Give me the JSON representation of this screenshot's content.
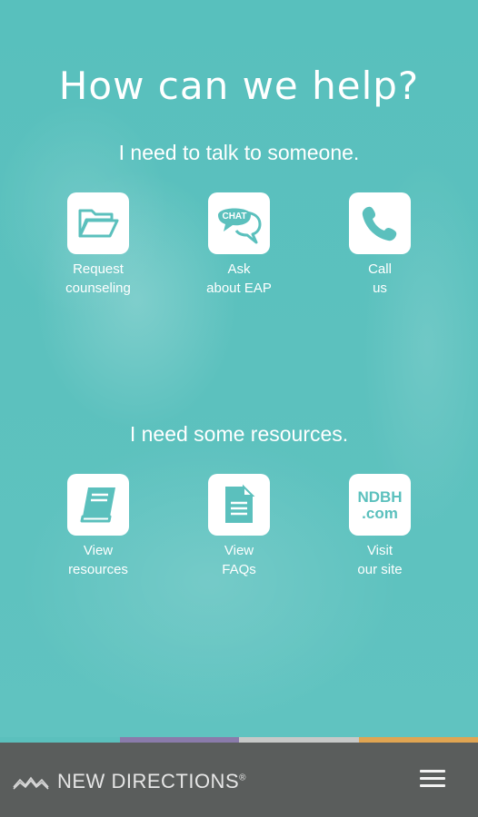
{
  "title": "How can we help?",
  "sections": [
    {
      "heading": "I need to talk to someone.",
      "tiles": [
        {
          "icon": "folder-icon",
          "label_line1": "Request",
          "label_line2": "counseling"
        },
        {
          "icon": "chat-icon",
          "icon_text": "CHAT",
          "label_line1": "Ask",
          "label_line2": "about EAP"
        },
        {
          "icon": "phone-icon",
          "label_line1": "Call",
          "label_line2": "us"
        }
      ]
    },
    {
      "heading": "I need some resources.",
      "tiles": [
        {
          "icon": "book-icon",
          "label_line1": "View",
          "label_line2": "resources"
        },
        {
          "icon": "document-icon",
          "label_line1": "View",
          "label_line2": "FAQs"
        },
        {
          "icon": "website-icon",
          "icon_text_line1": "NDBH",
          "icon_text_line2": ".com",
          "label_line1": "Visit",
          "label_line2": "our site"
        }
      ]
    }
  ],
  "color_bar": [
    "#5bc0bd",
    "#8a7bab",
    "#c7c9c8",
    "#e0a552"
  ],
  "footer": {
    "brand": "NEW DIRECTIONS",
    "brand_mark": "®",
    "menu_icon": "hamburger-menu-icon"
  },
  "colors": {
    "primary": "#5bc0bd",
    "icon": "#5bc0bd",
    "footer": "#5a5d5c"
  }
}
